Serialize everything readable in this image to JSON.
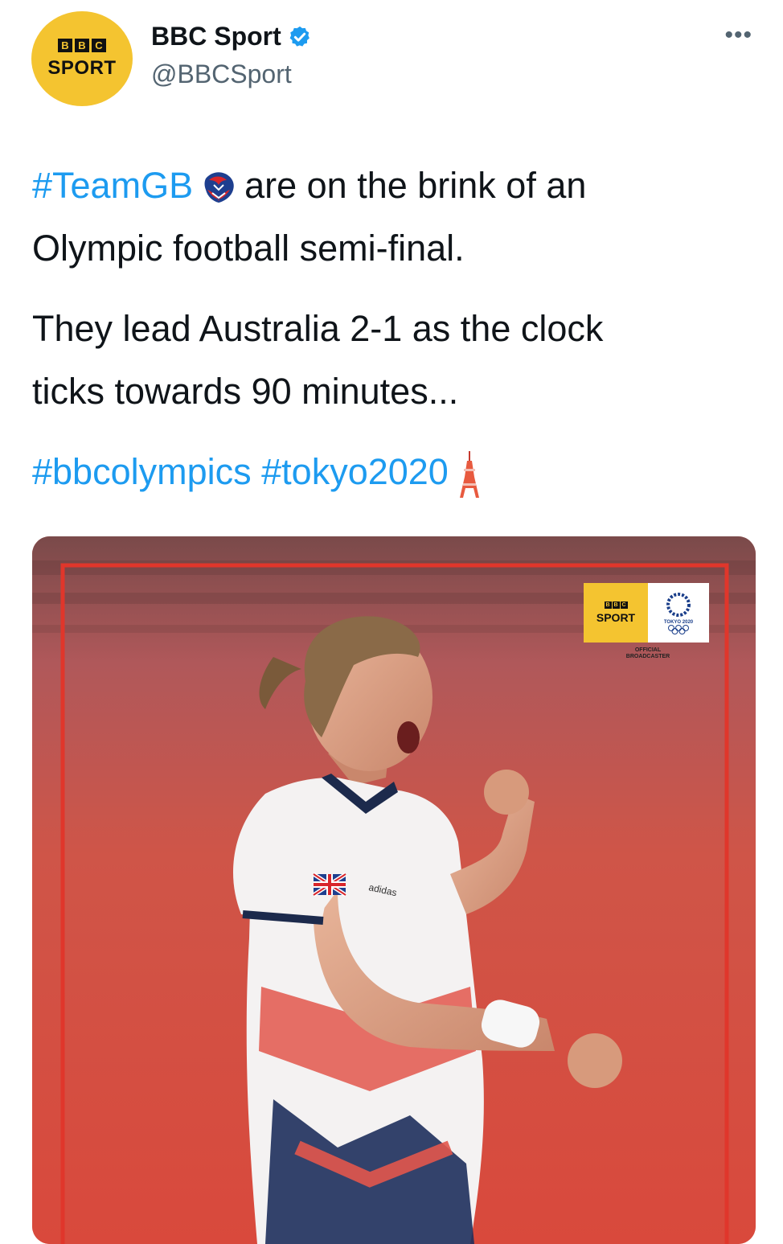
{
  "account": {
    "avatar_bbc_letters": [
      "B",
      "B",
      "C"
    ],
    "avatar_sport": "SPORT",
    "display_name": "BBC Sport",
    "handle": "@BBCSport",
    "verified_icon": "verified-badge-icon",
    "more_icon": "more-options-icon",
    "more_glyph": "•••"
  },
  "tweet": {
    "hashtag_teamgb": "#TeamGB",
    "line1_rest": "are on the brink of an",
    "line2": "Olympic football semi-final.",
    "para2_line1": "They lead Australia 2-1 as the clock",
    "para2_line2": "ticks towards 90 minutes...",
    "hashtag_bbcolympics": "#bbcolympics",
    "hashtag_tokyo2020": "#tokyo2020",
    "emoji_lion": "team-gb-lion-icon",
    "emoji_tower": "tokyo-tower-icon"
  },
  "media": {
    "badge_bbc_letters": [
      "B",
      "B",
      "C"
    ],
    "badge_sport": "SPORT",
    "badge_tokyo": "TOKYO 2020",
    "badge_official_line1": "OFFICIAL",
    "badge_official_line2": "BROADCASTER",
    "shirt_brand": "adidas"
  },
  "colors": {
    "link": "#1d9bf0",
    "bbc_yellow": "#f4c430",
    "frame_red": "#e0362b"
  }
}
